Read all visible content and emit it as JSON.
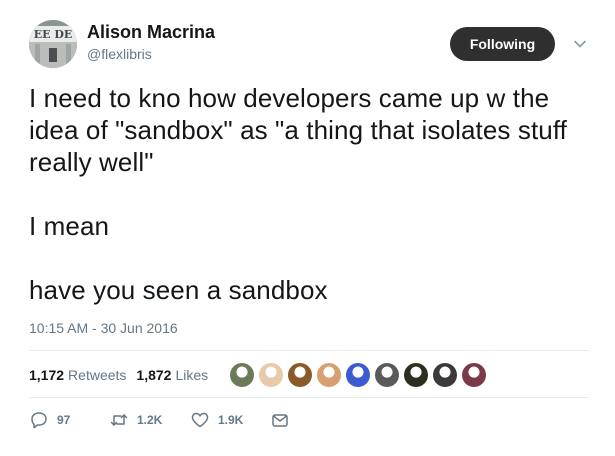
{
  "user": {
    "name": "Alison Macrina",
    "handle": "@flexlibris",
    "avatar_text": "EE DE"
  },
  "follow_button": {
    "label": "Following"
  },
  "tweet": {
    "paragraphs": [
      "I need to kno how developers came up w the idea of \"sandbox\" as \"a thing that isolates stuff really well\"",
      "I mean",
      "have you seen a sandbox"
    ],
    "timestamp": "10:15 AM - 30 Jun 2016"
  },
  "stats": {
    "retweets_count": "1,172",
    "retweets_label": "Retweets",
    "likes_count": "1,872",
    "likes_label": "Likes"
  },
  "likers": [
    {
      "color": "#6b7b5a"
    },
    {
      "color": "#e8c9a8"
    },
    {
      "color": "#8a5a2b"
    },
    {
      "color": "#d8a070"
    },
    {
      "color": "#3b5bd0"
    },
    {
      "color": "#5a5a5a"
    },
    {
      "color": "#2e2e1e"
    },
    {
      "color": "#3a3a3a"
    },
    {
      "color": "#7a3a4a"
    }
  ],
  "actions": {
    "reply_count": "97",
    "retweet_count": "1.2K",
    "like_count": "1.9K"
  },
  "colors": {
    "text": "#14171a",
    "muted": "#657786",
    "button_bg": "#2f2f2f",
    "divider": "#e6ecf0"
  },
  "icons": [
    "caret-down-icon",
    "reply-icon",
    "retweet-icon",
    "heart-icon",
    "envelope-icon"
  ]
}
